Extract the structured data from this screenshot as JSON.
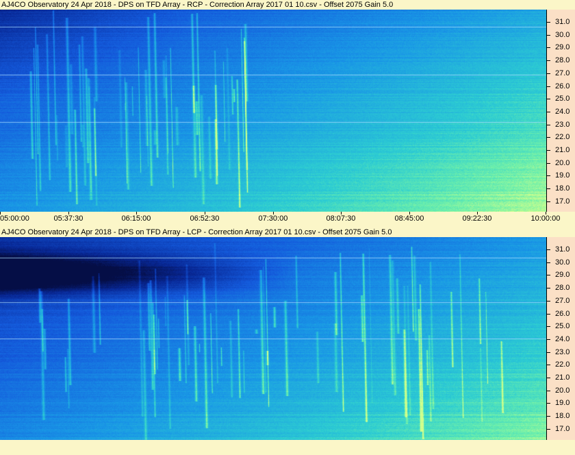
{
  "panels": [
    {
      "title": "AJ4CO Observatory 24 Apr 2018  -  DPS on TFD Array  -  RCP  -  Correction Array 2017 01 10.csv  -  Offset 2075  Gain 5.0",
      "y_ticks": [
        "31.0",
        "30.0",
        "29.0",
        "28.0",
        "27.0",
        "26.0",
        "25.0",
        "24.0",
        "23.0",
        "22.0",
        "21.0",
        "20.0",
        "19.0",
        "18.0",
        "17.0"
      ],
      "x_ticks": [
        "05:00:00",
        "05:37:30",
        "06:15:00",
        "06:52:30",
        "07:30:00",
        "08:07:30",
        "08:45:00",
        "09:22:30",
        "10:00:00"
      ]
    },
    {
      "title": "AJ4CO Observatory 24 Apr 2018  -  DPS on TFD Array  -  LCP  -  Correction Array 2017 01 10.csv  -  Offset 2075  Gain 5.0",
      "y_ticks": [
        "31.0",
        "30.0",
        "29.0",
        "28.0",
        "27.0",
        "26.0",
        "25.0",
        "24.0",
        "23.0",
        "22.0",
        "21.0",
        "20.0",
        "19.0",
        "18.0",
        "17.0"
      ]
    }
  ],
  "colors": {
    "background": "#fbf6c8",
    "axis_bg": "#fbe0c6",
    "spectrogram_low": "#0a2e9c",
    "spectrogram_high": "#7df5b0"
  }
}
